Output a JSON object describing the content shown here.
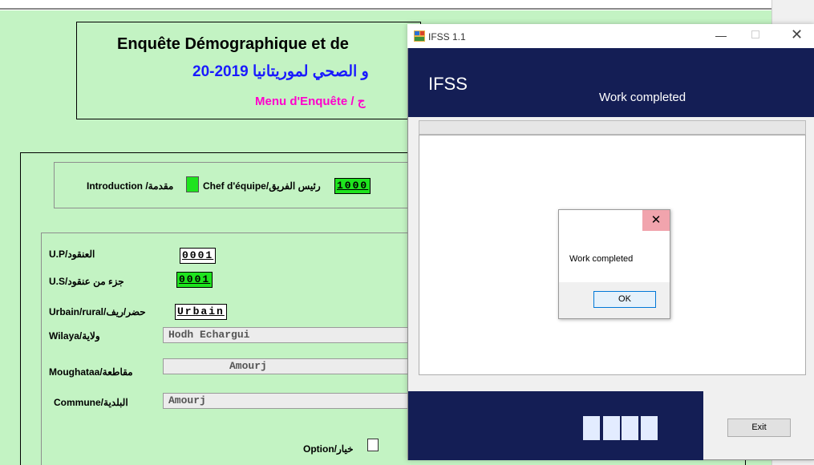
{
  "survey": {
    "title_fr": "Enquête Démographique et de",
    "title_ar": "و الصحي لموريتانيا 2019-20",
    "menu_label": "Menu d'Enquête / ج",
    "intro_label": "Introduction /مقدمة",
    "chef_label": "Chef d'équipe/رئيس الفريق",
    "chef_code": "1000",
    "up_label": "U.P/العنقود",
    "up_code": "0001",
    "us_label": "U.S/جزء من عنقود",
    "us_code": "0001",
    "ur_label": "Urbain/rural/حضر/ريف",
    "ur_code": "Urbain",
    "wilaya_label": "Wilaya/ولاية",
    "wilaya_value": "Hodh Echargui",
    "moughataa_label": "Moughataa/مقاطعة",
    "moughataa_value": "Amourj",
    "commune_label": "Commune/البلدية",
    "commune_value": "Amourj",
    "option_label": "Option/خيار"
  },
  "ifss": {
    "window_title": "IFSS 1.1",
    "minimize_glyph": "—",
    "close_glyph": "✕",
    "brand": "IFSS",
    "status": "Work completed",
    "exit_label": "Exit",
    "header_color": "#141e55"
  },
  "dialog": {
    "message": "Work completed",
    "ok_label": "OK",
    "close_glyph": "✕"
  }
}
